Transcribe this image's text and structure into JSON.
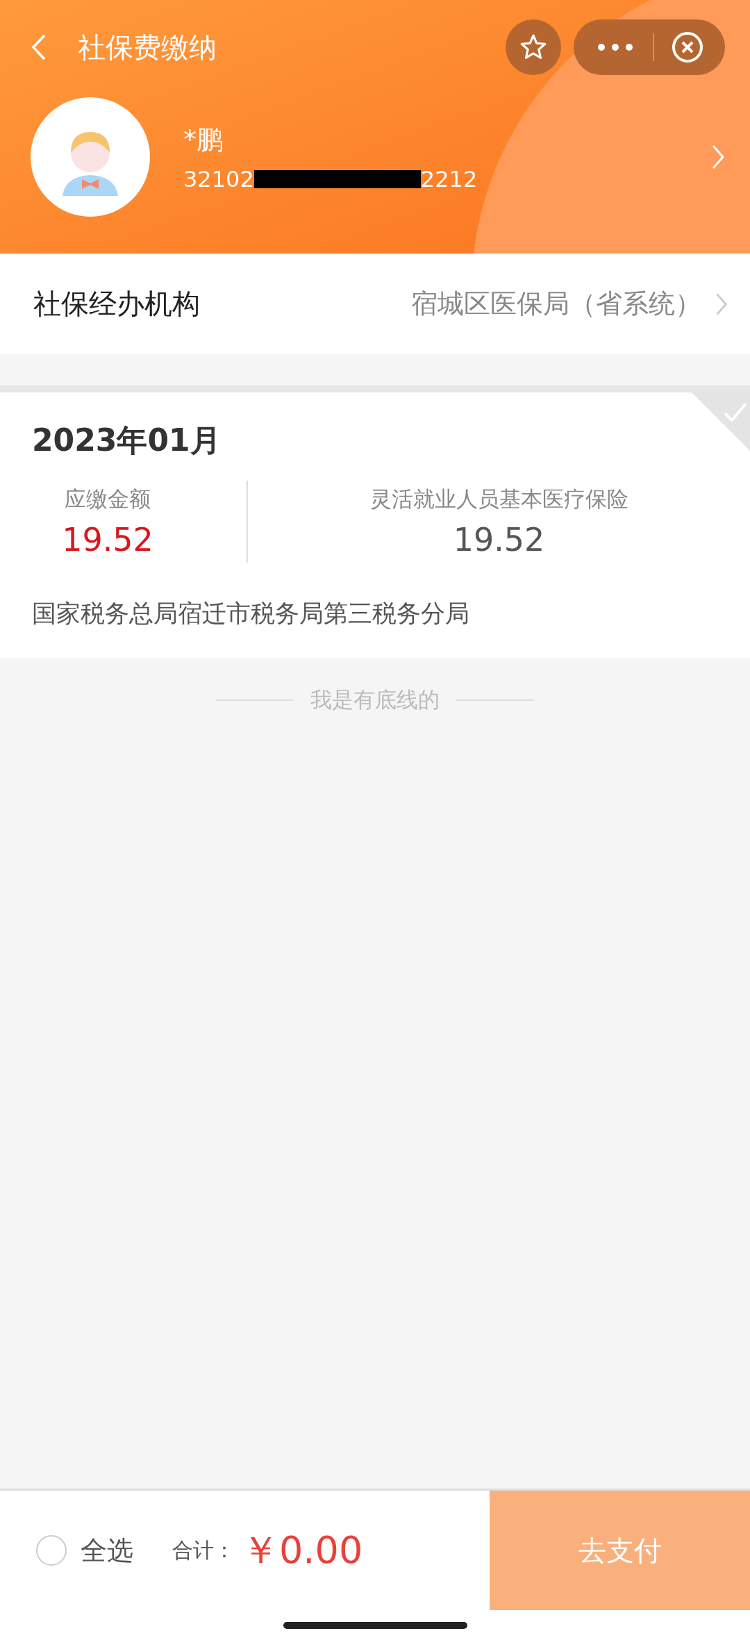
{
  "nav": {
    "title": "社保费缴纳"
  },
  "user": {
    "name": "*鹏",
    "id_prefix": "32102",
    "id_suffix": "2212"
  },
  "agency": {
    "label": "社保经办机构",
    "value": "宿城区医保局（省系统）"
  },
  "bills": [
    {
      "period": "2023年01月",
      "checked": false,
      "due_label": "应缴金额",
      "due_amount": "19.52",
      "item_label": "灵活就业人员基本医疗保险",
      "item_amount": "19.52",
      "office": "国家税务总局宿迁市税务局第三税务分局"
    }
  ],
  "end_note": "我是有底线的",
  "footer": {
    "select_all": {
      "label": "全选",
      "checked": false
    },
    "total_label": "合计：",
    "total": "￥0.00",
    "pay_button": {
      "label": "去支付",
      "disabled": true
    }
  }
}
